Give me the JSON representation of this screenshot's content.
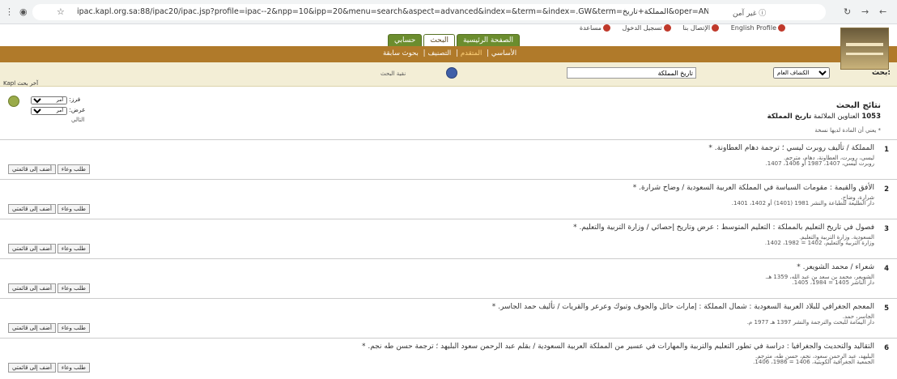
{
  "browser": {
    "url": "ipac.kapl.org.sa:88/ipac20/ipac.jsp?profile=ipac--2&npp=10&ipp=20&menu=search&aspect=advanced&index=&term=&index=.GW&term=المملكة+تاريخ&oper=AND&index=.TI&ter...",
    "security_chip": "غير آمن"
  },
  "header": {
    "top_links": [
      "English Profile",
      "الإتصال بنا",
      "تسجيل الدخول",
      "مساعدة"
    ],
    "tabs": [
      "الصفحة الرئيسية",
      "البحث",
      "حسابي"
    ]
  },
  "nav": {
    "links": [
      "الأساسي",
      "المتقدم",
      "التصنيف",
      "بحوث سابقة"
    ]
  },
  "search": {
    "label": "بحث:",
    "select_value": "الكشاف العام",
    "term": "تاريخ المملكة",
    "go_label": "نقية البحث",
    "advanced_link": "آخر بحث Kapl"
  },
  "results_header": {
    "title": "نتائج البحث",
    "count": "1053",
    "count_label": "العناوين الملائمة",
    "query": "تاريخ المملكة",
    "note": "* يعني أن المادة لديها نسخة"
  },
  "controls": {
    "sort_label": "فرز:",
    "sort_value": "أمر",
    "show_label": "عرض:",
    "show_value": "أمر",
    "next": "التالي"
  },
  "results": [
    {
      "num": "1",
      "title": "المملكة / تأليف روبرت ليسي ؛ ترجمة دهام العطاونة. *",
      "d1": "ليسي، روبرت، العطاونة، دهام، مترجم.",
      "d2": "روبرت ليسي، 1407، 1987 أو 1406، 1407.",
      "d3": ""
    },
    {
      "num": "2",
      "title": "الأفق والقيمة : مقومات السياسة في المملكة العربية السعودية / وضاح شرارة. *",
      "d1": "شرارة، وضاح.",
      "d2": "دار الطليعة للطباعة والنشر 1981 (1401) أو 1402، 1401.",
      "d3": ""
    },
    {
      "num": "3",
      "title": "فصول في تاريخ التعليم بالمملكة : التعليم المتوسط : عرض وتاريخ إحصائي / وزارة التربية والتعليم. *",
      "d1": "السعودية. وزارة التربية والتعليم.",
      "d2": "وزارة التربية والتعليم، 1402 = 1982، 1402.",
      "d3": ""
    },
    {
      "num": "4",
      "title": "شعراء / محمد الشويعر. *",
      "d1": "الشويعر، محمد بن سعد بن عبد الله، 1359 هـ.",
      "d2": "دار الناشر 1405 = 1984، 1405.",
      "d3": ""
    },
    {
      "num": "5",
      "title": "المعجم الجغرافي للبلاد العربية السعودية : شمال المملكة : إمارات حائل والجوف وتبوك وعرعر والقريات / تأليف حمد الجاسر. *",
      "d1": "الجاسر، حمد.",
      "d2": "دار اليمامة للبحث والترجمة والنشر 1397 هـ 1977 م.",
      "d3": ""
    },
    {
      "num": "6",
      "title": "التقاليد والتحديث والجغرافيا : دراسة في تطور التعليم والتربية والمهارات في عسير من المملكة العربية السعودية / بقلم عبد الرحمن سعود البليهد ؛ ترجمة حسن طه نجم. *",
      "d1": "البليهد، عبد الرحمن سعود، نجم، حسن طه، مترجم.",
      "d2": "الجمعية الجغرافية الكويتية، 1406 = 1986، 1406.",
      "d3": ""
    }
  ],
  "buttons": {
    "add": "أضف إلى قائمتي",
    "request": "طلب وعاء"
  }
}
